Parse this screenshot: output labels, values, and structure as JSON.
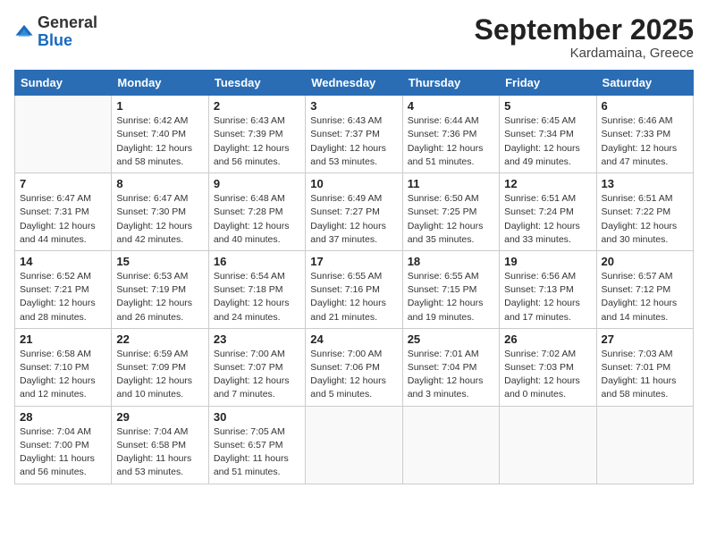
{
  "logo": {
    "general": "General",
    "blue": "Blue"
  },
  "title": "September 2025",
  "location": "Kardamaina, Greece",
  "days_of_week": [
    "Sunday",
    "Monday",
    "Tuesday",
    "Wednesday",
    "Thursday",
    "Friday",
    "Saturday"
  ],
  "weeks": [
    [
      {
        "day": "",
        "info": ""
      },
      {
        "day": "1",
        "info": "Sunrise: 6:42 AM\nSunset: 7:40 PM\nDaylight: 12 hours and 58 minutes."
      },
      {
        "day": "2",
        "info": "Sunrise: 6:43 AM\nSunset: 7:39 PM\nDaylight: 12 hours and 56 minutes."
      },
      {
        "day": "3",
        "info": "Sunrise: 6:43 AM\nSunset: 7:37 PM\nDaylight: 12 hours and 53 minutes."
      },
      {
        "day": "4",
        "info": "Sunrise: 6:44 AM\nSunset: 7:36 PM\nDaylight: 12 hours and 51 minutes."
      },
      {
        "day": "5",
        "info": "Sunrise: 6:45 AM\nSunset: 7:34 PM\nDaylight: 12 hours and 49 minutes."
      },
      {
        "day": "6",
        "info": "Sunrise: 6:46 AM\nSunset: 7:33 PM\nDaylight: 12 hours and 47 minutes."
      }
    ],
    [
      {
        "day": "7",
        "info": "Sunrise: 6:47 AM\nSunset: 7:31 PM\nDaylight: 12 hours and 44 minutes."
      },
      {
        "day": "8",
        "info": "Sunrise: 6:47 AM\nSunset: 7:30 PM\nDaylight: 12 hours and 42 minutes."
      },
      {
        "day": "9",
        "info": "Sunrise: 6:48 AM\nSunset: 7:28 PM\nDaylight: 12 hours and 40 minutes."
      },
      {
        "day": "10",
        "info": "Sunrise: 6:49 AM\nSunset: 7:27 PM\nDaylight: 12 hours and 37 minutes."
      },
      {
        "day": "11",
        "info": "Sunrise: 6:50 AM\nSunset: 7:25 PM\nDaylight: 12 hours and 35 minutes."
      },
      {
        "day": "12",
        "info": "Sunrise: 6:51 AM\nSunset: 7:24 PM\nDaylight: 12 hours and 33 minutes."
      },
      {
        "day": "13",
        "info": "Sunrise: 6:51 AM\nSunset: 7:22 PM\nDaylight: 12 hours and 30 minutes."
      }
    ],
    [
      {
        "day": "14",
        "info": "Sunrise: 6:52 AM\nSunset: 7:21 PM\nDaylight: 12 hours and 28 minutes."
      },
      {
        "day": "15",
        "info": "Sunrise: 6:53 AM\nSunset: 7:19 PM\nDaylight: 12 hours and 26 minutes."
      },
      {
        "day": "16",
        "info": "Sunrise: 6:54 AM\nSunset: 7:18 PM\nDaylight: 12 hours and 24 minutes."
      },
      {
        "day": "17",
        "info": "Sunrise: 6:55 AM\nSunset: 7:16 PM\nDaylight: 12 hours and 21 minutes."
      },
      {
        "day": "18",
        "info": "Sunrise: 6:55 AM\nSunset: 7:15 PM\nDaylight: 12 hours and 19 minutes."
      },
      {
        "day": "19",
        "info": "Sunrise: 6:56 AM\nSunset: 7:13 PM\nDaylight: 12 hours and 17 minutes."
      },
      {
        "day": "20",
        "info": "Sunrise: 6:57 AM\nSunset: 7:12 PM\nDaylight: 12 hours and 14 minutes."
      }
    ],
    [
      {
        "day": "21",
        "info": "Sunrise: 6:58 AM\nSunset: 7:10 PM\nDaylight: 12 hours and 12 minutes."
      },
      {
        "day": "22",
        "info": "Sunrise: 6:59 AM\nSunset: 7:09 PM\nDaylight: 12 hours and 10 minutes."
      },
      {
        "day": "23",
        "info": "Sunrise: 7:00 AM\nSunset: 7:07 PM\nDaylight: 12 hours and 7 minutes."
      },
      {
        "day": "24",
        "info": "Sunrise: 7:00 AM\nSunset: 7:06 PM\nDaylight: 12 hours and 5 minutes."
      },
      {
        "day": "25",
        "info": "Sunrise: 7:01 AM\nSunset: 7:04 PM\nDaylight: 12 hours and 3 minutes."
      },
      {
        "day": "26",
        "info": "Sunrise: 7:02 AM\nSunset: 7:03 PM\nDaylight: 12 hours and 0 minutes."
      },
      {
        "day": "27",
        "info": "Sunrise: 7:03 AM\nSunset: 7:01 PM\nDaylight: 11 hours and 58 minutes."
      }
    ],
    [
      {
        "day": "28",
        "info": "Sunrise: 7:04 AM\nSunset: 7:00 PM\nDaylight: 11 hours and 56 minutes."
      },
      {
        "day": "29",
        "info": "Sunrise: 7:04 AM\nSunset: 6:58 PM\nDaylight: 11 hours and 53 minutes."
      },
      {
        "day": "30",
        "info": "Sunrise: 7:05 AM\nSunset: 6:57 PM\nDaylight: 11 hours and 51 minutes."
      },
      {
        "day": "",
        "info": ""
      },
      {
        "day": "",
        "info": ""
      },
      {
        "day": "",
        "info": ""
      },
      {
        "day": "",
        "info": ""
      }
    ]
  ]
}
